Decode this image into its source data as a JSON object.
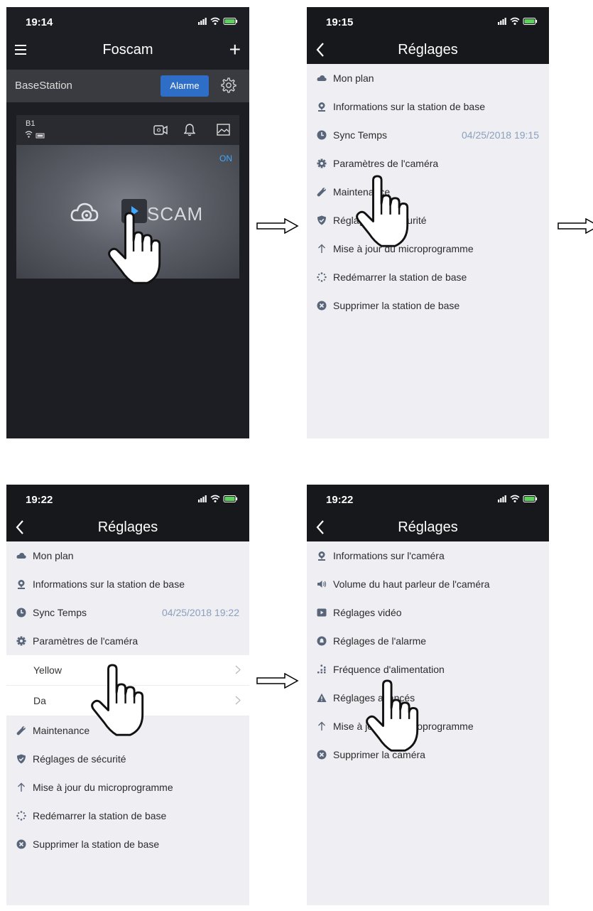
{
  "screen1": {
    "time": "19:14",
    "title": "Foscam",
    "base_station": "BaseStation",
    "alarm_button": "Alarme",
    "camera_label": "B1",
    "status_on": "ON",
    "logo_text": "SCAM"
  },
  "screen2": {
    "time": "19:15",
    "title": "Réglages",
    "items": [
      {
        "label": "Mon plan",
        "icon": "cloud-icon"
      },
      {
        "label": "Informations sur la station de base",
        "icon": "location-pin-icon"
      },
      {
        "label": "Sync Temps",
        "value": "04/25/2018 19:15",
        "icon": "clock-icon"
      },
      {
        "label": "Paramètres de l'caméra",
        "icon": "gear-icon"
      },
      {
        "label": "Maintenance",
        "icon": "wrench-icon"
      },
      {
        "label": "Réglages de sécurité",
        "icon": "shield-icon"
      },
      {
        "label": "Mise à jour du microprogramme",
        "icon": "arrow-up-icon"
      },
      {
        "label": "Redémarrer la station de base",
        "icon": "spinner-icon"
      },
      {
        "label": "Supprimer la station de base",
        "icon": "delete-circle-icon"
      }
    ]
  },
  "screen3": {
    "time": "19:22",
    "title": "Réglages",
    "items_top": [
      {
        "label": "Mon plan",
        "icon": "cloud-icon"
      },
      {
        "label": "Informations sur la station de base",
        "icon": "location-pin-icon"
      },
      {
        "label": "Sync Temps",
        "value": "04/25/2018 19:22",
        "icon": "clock-icon"
      },
      {
        "label": "Paramètres de l'caméra",
        "icon": "gear-icon"
      }
    ],
    "cameras": [
      "Yellow",
      "Da"
    ],
    "items_bottom": [
      {
        "label": "Maintenance",
        "icon": "wrench-icon"
      },
      {
        "label": "Réglages de sécurité",
        "icon": "shield-icon"
      },
      {
        "label": "Mise à jour du microprogramme",
        "icon": "arrow-up-icon"
      },
      {
        "label": "Redémarrer la station de base",
        "icon": "spinner-icon"
      },
      {
        "label": "Supprimer la station de base",
        "icon": "delete-circle-icon"
      }
    ]
  },
  "screen4": {
    "time": "19:22",
    "title": "Réglages",
    "items": [
      {
        "label": "Informations sur l'caméra",
        "icon": "location-pin-icon"
      },
      {
        "label": "Volume du haut parleur de l'caméra",
        "icon": "speaker-icon"
      },
      {
        "label": "Réglages vidéo",
        "icon": "video-icon"
      },
      {
        "label": "Réglages de l'alarme",
        "icon": "alarm-icon"
      },
      {
        "label": "Fréquence d'alimentation",
        "icon": "frequency-icon"
      },
      {
        "label": "Réglages avancés",
        "icon": "warning-triangle-icon"
      },
      {
        "label": "Mise à jour du microprogramme",
        "icon": "arrow-up-icon"
      },
      {
        "label": "Supprimer la caméra",
        "icon": "delete-circle-icon"
      }
    ]
  },
  "colors": {
    "dark_bg": "#1d1e23",
    "accent": "#2f6ec6",
    "list_bg": "#eeeef3",
    "icon": "#59667a",
    "value": "#8aa0bd"
  }
}
